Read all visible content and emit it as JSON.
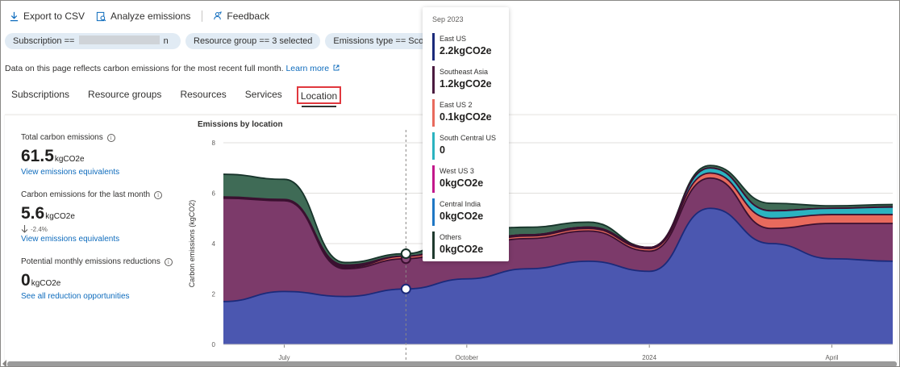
{
  "toolbar": {
    "export_label": "Export to CSV",
    "analyze_label": "Analyze emissions",
    "feedback_label": "Feedback"
  },
  "filters": {
    "subscription": "Subscription ==",
    "subscription_tail": "n",
    "resource_group": "Resource group == 3 selected",
    "emissions_type": "Emissions type == Scope"
  },
  "info": {
    "text": "Data on this page reflects carbon emissions for the most recent full month.",
    "link": "Learn more"
  },
  "tabs": [
    "Subscriptions",
    "Resource groups",
    "Resources",
    "Services",
    "Location"
  ],
  "active_tab": "Location",
  "stats": {
    "total_label": "Total carbon emissions",
    "total_value": "61.5",
    "total_unit": "kgCO2e",
    "total_link": "View emissions equivalents",
    "month_label": "Carbon emissions for the last month",
    "month_value": "5.6",
    "month_unit": "kgCO2e",
    "month_delta": "-2.4%",
    "month_link": "View emissions equivalents",
    "reduction_label": "Potential monthly emissions reductions",
    "reduction_value": "0",
    "reduction_unit": "kgCO2e",
    "reduction_link": "See all reduction opportunities"
  },
  "chart_data": {
    "type": "area",
    "title": "Emissions by location",
    "ylabel": "Carbon emissions (kgCO2)",
    "ylim": [
      0,
      8
    ],
    "yticks": [
      0,
      2,
      4,
      6,
      8
    ],
    "xticks": [
      "July",
      "October",
      "2024",
      "April"
    ],
    "grid": true,
    "x": [
      "2023-06",
      "2023-07",
      "2023-08",
      "2023-09",
      "2023-10",
      "2023-11",
      "2023-12",
      "2024-01",
      "2024-02",
      "2024-03",
      "2024-04",
      "2024-05"
    ],
    "series": [
      {
        "name": "East US",
        "color": "#4b57b0",
        "values": [
          1.7,
          2.1,
          1.9,
          2.2,
          2.6,
          3.0,
          3.3,
          2.9,
          5.4,
          4.0,
          3.4,
          3.3
        ]
      },
      {
        "name": "Southeast Asia",
        "color": "#7c3a6a",
        "values": [
          4.1,
          3.6,
          1.1,
          1.2,
          1.3,
          1.2,
          1.2,
          0.8,
          1.2,
          0.6,
          1.4,
          1.5
        ]
      },
      {
        "name": "East US 2",
        "color": "#e86a5d",
        "values": [
          0.0,
          0.0,
          0.05,
          0.1,
          0.1,
          0.1,
          0.1,
          0.1,
          0.2,
          0.4,
          0.35,
          0.35
        ]
      },
      {
        "name": "South Central US",
        "color": "#2bb3c0",
        "values": [
          0.0,
          0.0,
          0.05,
          0.0,
          0.05,
          0.05,
          0.05,
          0.05,
          0.2,
          0.3,
          0.25,
          0.3
        ]
      },
      {
        "name": "West US 3",
        "color": "#c2188b",
        "values": [
          0.0,
          0.0,
          0.0,
          0.0,
          0.0,
          0.0,
          0.0,
          0.0,
          0.0,
          0.0,
          0.0,
          0.0
        ]
      },
      {
        "name": "Central India",
        "color": "#1f77c4",
        "values": [
          0.05,
          0.05,
          0.05,
          0.0,
          0.0,
          0.0,
          0.0,
          0.0,
          0.0,
          0.0,
          0.0,
          0.0
        ]
      },
      {
        "name": "Others",
        "color": "#3f6b56",
        "values": [
          0.9,
          0.8,
          0.1,
          0.1,
          0.5,
          0.3,
          0.2,
          0.0,
          0.1,
          0.3,
          0.1,
          0.1
        ]
      }
    ],
    "hover_index": 3
  },
  "tooltip": {
    "header": "Sep 2023",
    "items": [
      {
        "name": "East US",
        "value": "2.2kgCO2e",
        "color": "#1b2a7a"
      },
      {
        "name": "Southeast Asia",
        "value": "1.2kgCO2e",
        "color": "#4a1a3f"
      },
      {
        "name": "East US 2",
        "value": "0.1kgCO2e",
        "color": "#e86a5d"
      },
      {
        "name": "South Central US",
        "value": "0",
        "color": "#2bb3c0"
      },
      {
        "name": "West US 3",
        "value": "0kgCO2e",
        "color": "#c2188b"
      },
      {
        "name": "Central India",
        "value": "0kgCO2e",
        "color": "#1f77c4"
      },
      {
        "name": "Others",
        "value": "0kgCO2e",
        "color": "#1f3a2e"
      }
    ]
  },
  "icons": {
    "download": "download-icon",
    "analyze": "analyze-icon",
    "feedback": "feedback-icon",
    "info": "info-icon",
    "external": "external-link-icon",
    "arrow_down": "arrow-down-icon"
  }
}
